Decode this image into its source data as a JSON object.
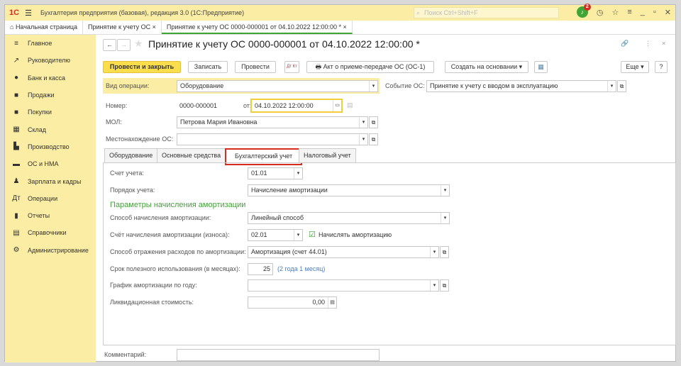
{
  "app": {
    "logo": "1С",
    "title": "Бухгалтерия предприятия (базовая), редакция 3.0  (1С:Предприятие)",
    "search_placeholder": "Поиск Ctrl+Shift+F",
    "notifications": "2"
  },
  "tabs": [
    {
      "label": "Начальная страница"
    },
    {
      "label": "Принятие к учету ОС ×"
    },
    {
      "label": "Принятие к учету ОС 0000-000001 от 04.10.2022 12:00:00 * ×"
    }
  ],
  "sidebar": {
    "items": [
      {
        "label": "Главное",
        "icon": "≡"
      },
      {
        "label": "Руководителю",
        "icon": "↗"
      },
      {
        "label": "Банк и касса",
        "icon": "●"
      },
      {
        "label": "Продажи",
        "icon": "■"
      },
      {
        "label": "Покупки",
        "icon": "■"
      },
      {
        "label": "Склад",
        "icon": "▦"
      },
      {
        "label": "Производство",
        "icon": "▙"
      },
      {
        "label": "ОС и НМА",
        "icon": "▬"
      },
      {
        "label": "Зарплата и кадры",
        "icon": "♟"
      },
      {
        "label": "Операции",
        "icon": "Дт"
      },
      {
        "label": "Отчеты",
        "icon": "▮"
      },
      {
        "label": "Справочники",
        "icon": "▤"
      },
      {
        "label": "Администрирование",
        "icon": "⚙"
      }
    ]
  },
  "doc": {
    "title": "Принятие к учету ОС 0000-000001 от 04.10.2022 12:00:00 *"
  },
  "toolbar": {
    "post_close": "Провести и закрыть",
    "save": "Записать",
    "post": "Провести",
    "dtkt": "Дт Кт",
    "act": "Акт о приеме-передаче ОС (ОС-1)",
    "create_based": "Создать на основании ▾",
    "more": "Еще ▾",
    "help": "?"
  },
  "header": {
    "op_label": "Вид операции:",
    "op_value": "Оборудование",
    "event_label": "Событие ОС:",
    "event_value": "Принятие к учету с вводом в эксплуатацию",
    "num_label": "Номер:",
    "num_value": "0000-000001",
    "date_label": "от:",
    "date_value": "04.10.2022 12:00:00",
    "mol_label": "МОЛ:",
    "mol_value": "Петрова Мария Ивановна",
    "loc_label": "Местонахождение ОС:",
    "loc_value": ""
  },
  "form_tabs": [
    "Оборудование",
    "Основные средства",
    "Бухгалтерский учет",
    "Налоговый учет"
  ],
  "accounting": {
    "account_label": "Счет учета:",
    "account_value": "01.01",
    "order_label": "Порядок учета:",
    "order_value": "Начисление амортизации",
    "section_title": "Параметры начисления амортизации",
    "method_label": "Способ начисления амортизации:",
    "method_value": "Линейный способ",
    "dep_account_label": "Счёт начисления амортизации (износа):",
    "dep_account_value": "02.01",
    "accrue_label": "Начислять амортизацию",
    "accrue_checked": true,
    "expense_label": "Способ отражения расходов по амортизации:",
    "expense_value": "Амортизация (счет 44.01)",
    "life_label": "Срок полезного использования (в месяцах):",
    "life_value": "25",
    "life_hint": "(2 года 1 месяц)",
    "schedule_label": "График амортизации по году:",
    "schedule_value": "",
    "salvage_label": "Ликвидационная стоимость:",
    "salvage_value": "0,00"
  },
  "comment": {
    "label": "Комментарий:",
    "value": ""
  },
  "colors": {
    "accent": "#fcde4c",
    "panel": "#fbeda3",
    "section": "#3fa535",
    "highlight": "#d62b1e"
  }
}
